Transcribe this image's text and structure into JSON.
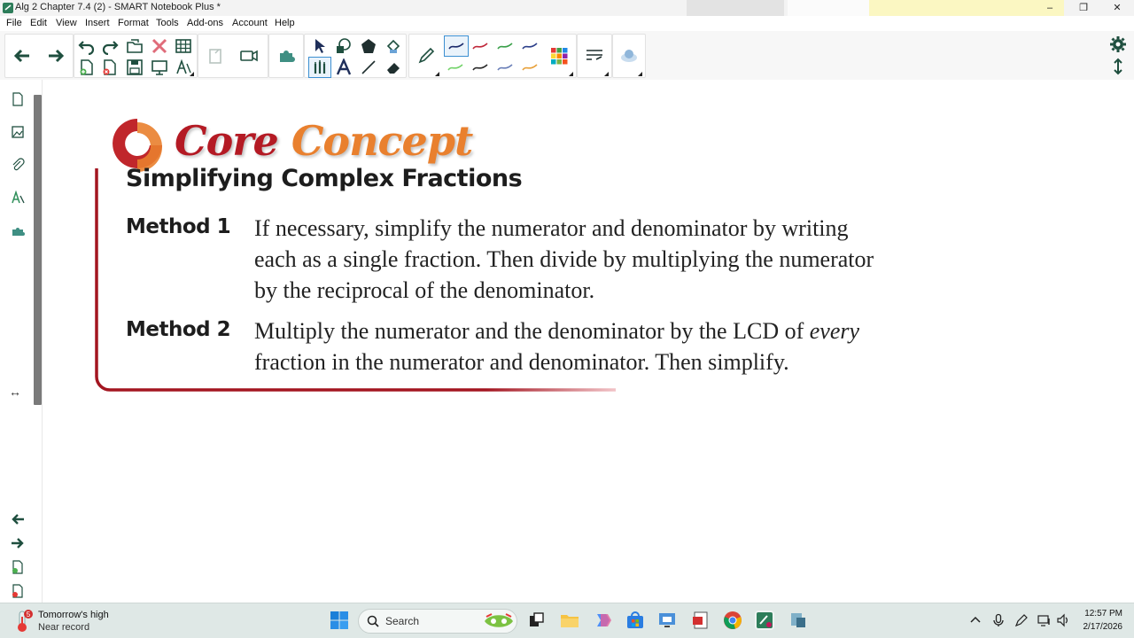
{
  "window": {
    "title": "Alg 2 Chapter 7.4 (2) - SMART Notebook Plus *",
    "minimize": "–",
    "restore": "❐",
    "close": "✕"
  },
  "menu": [
    "File",
    "Edit",
    "View",
    "Insert",
    "Format",
    "Tools",
    "Add-ons",
    "Account",
    "Help"
  ],
  "toolbar": {
    "icons": [
      "back-arrow-icon",
      "forward-arrow-icon",
      "undo-icon",
      "redo-icon",
      "open-file-icon",
      "delete-icon",
      "table-icon",
      "add-page-icon",
      "delete-page-icon",
      "save-icon",
      "screen-shade-icon",
      "properties-icon",
      "paste-icon",
      "video-camera-icon",
      "add-on-icon",
      "select-icon",
      "shapes-icon",
      "polygon-icon",
      "fill-icon",
      "magic-pen-icon",
      "text-icon",
      "line-icon",
      "eraser-icon",
      "pen-icon",
      "color-palette-icon",
      "line-style-icon",
      "fill-effects-icon"
    ],
    "pen_colors": [
      "#1b2a6b",
      "#c0283a",
      "#3aa04a",
      "#2c3f8a",
      "#73d36a",
      "#2a2a2a",
      "#6a7fb8",
      "#e8a13b"
    ],
    "palette_colors": [
      "#e53935",
      "#43a047",
      "#1e88e5",
      "#fdd835",
      "#fb8c00",
      "#8e24aa",
      "#00acc1",
      "#7cb342",
      "#f4511e"
    ]
  },
  "sidebar": {
    "icons": [
      "page-sorter-icon",
      "gallery-icon",
      "attachments-icon",
      "properties-tab-icon",
      "add-ons-tab-icon"
    ],
    "resize_glyph": "↔",
    "bottom_icons": [
      "previous-page-icon",
      "next-page-icon",
      "add-page-icon",
      "delete-page-icon"
    ]
  },
  "right_tools": [
    "settings-gear-icon",
    "move-toolbar-icon"
  ],
  "slide": {
    "core_word": "Core",
    "concept_word": "Concept",
    "heading": "Simplifying Complex Fractions",
    "methods": [
      {
        "label": "Method 1",
        "lines": [
          "If necessary, simplify the numerator and denominator by writing",
          "each as a single fraction. Then divide by multiplying the numerator",
          "by the reciprocal of the denominator."
        ]
      },
      {
        "label": "Method 2",
        "line1_start": "Multiply the numerator and the denominator by the LCD of ",
        "line1_em": "every",
        "line2": "fraction in the numerator and denominator. Then simplify."
      }
    ],
    "colors": {
      "core": "#b41a24",
      "concept": "#e9802e",
      "frame": "#a31520"
    }
  },
  "taskbar": {
    "weather_badge": "5",
    "weather_title": "Tomorrow's high",
    "weather_subtitle": "Near record",
    "search_label": "Search",
    "apps": [
      "task-view-icon",
      "file-explorer-icon",
      "copilot-icon",
      "store-icon",
      "remote-desktop-icon",
      "adobe-reader-icon",
      "chrome-icon",
      "smart-notebook-icon",
      "smart-tools-icon"
    ],
    "tray": [
      "chevron-up-icon",
      "microphone-icon",
      "pen-tray-icon",
      "network-icon",
      "volume-icon"
    ],
    "time": "12:57 PM",
    "date": "2/17/2026"
  }
}
